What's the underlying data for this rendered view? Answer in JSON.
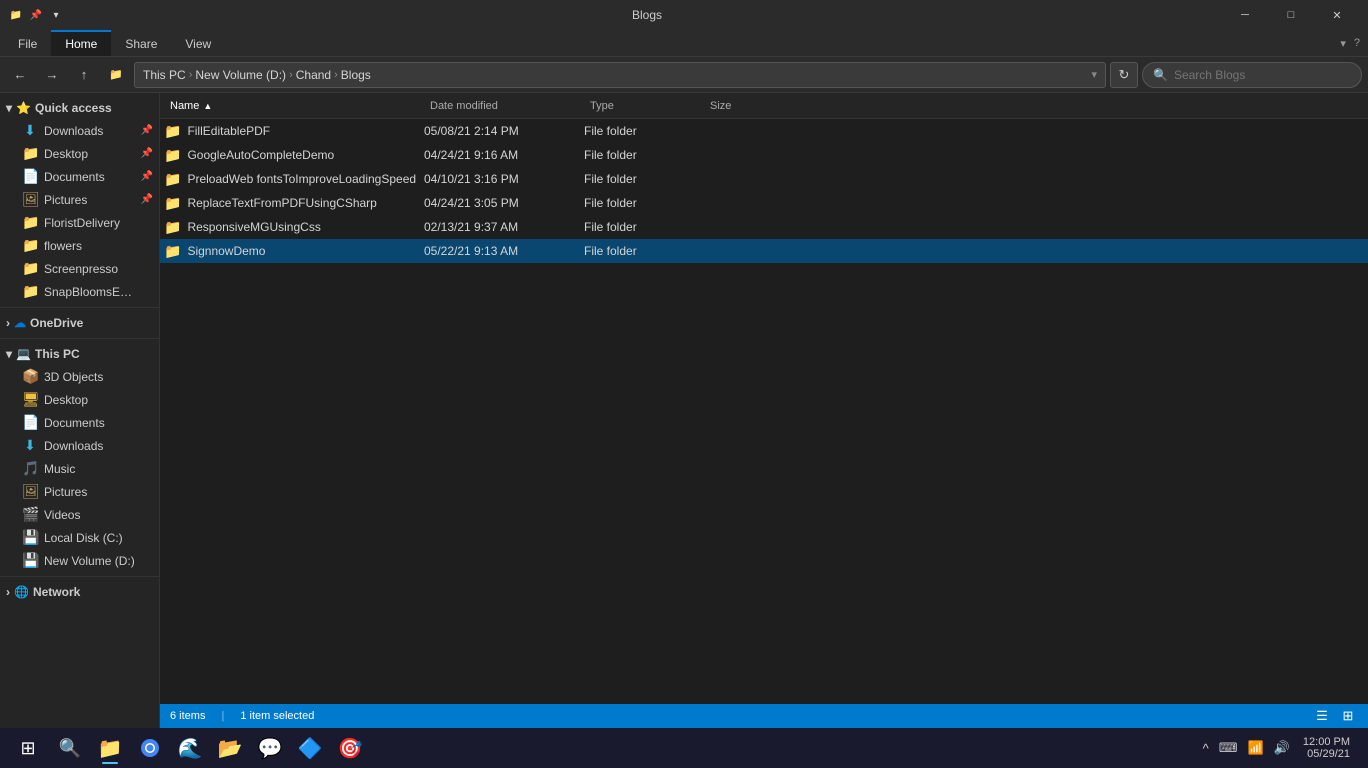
{
  "titlebar": {
    "title": "Blogs",
    "pin_label": "📌",
    "minimize_label": "─",
    "maximize_label": "□",
    "close_label": "✕"
  },
  "ribbon": {
    "tabs": [
      "File",
      "Home",
      "Share",
      "View"
    ],
    "active_tab": "Home",
    "help_icon": "?"
  },
  "addressbar": {
    "back_icon": "←",
    "forward_icon": "→",
    "up_icon": "↑",
    "breadcrumbs": [
      "This PC",
      "New Volume (D:)",
      "Chand",
      "Blogs"
    ],
    "refresh_icon": "↻",
    "search_placeholder": "Search Blogs"
  },
  "sidebar": {
    "sections": [
      {
        "id": "quick-access",
        "label": "Quick access",
        "icon": "⭐",
        "expanded": true,
        "items": [
          {
            "id": "downloads",
            "label": "Downloads",
            "icon": "⬇",
            "icon_class": "folder-download",
            "pinned": true
          },
          {
            "id": "desktop",
            "label": "Desktop",
            "icon": "🖥",
            "icon_class": "folder-yellow",
            "pinned": true
          },
          {
            "id": "documents",
            "label": "Documents",
            "icon": "📄",
            "icon_class": "folder-docs",
            "pinned": true
          },
          {
            "id": "pictures",
            "label": "Pictures",
            "icon": "🖼",
            "icon_class": "folder-pics",
            "pinned": true
          },
          {
            "id": "floristdelivery",
            "label": "FloristDelivery",
            "icon": "📁",
            "icon_class": "folder-yellow"
          },
          {
            "id": "flowers",
            "label": "flowers",
            "icon": "📁",
            "icon_class": "folder-yellow"
          },
          {
            "id": "screenpresso",
            "label": "Screenpresso",
            "icon": "📁",
            "icon_class": "folder-yellow"
          },
          {
            "id": "snapblooms",
            "label": "SnapBloomsEcomm",
            "icon": "📁",
            "icon_class": "folder-yellow"
          }
        ]
      },
      {
        "id": "onedrive",
        "label": "OneDrive",
        "icon": "☁",
        "expanded": false,
        "items": []
      },
      {
        "id": "thispc",
        "label": "This PC",
        "icon": "💻",
        "expanded": true,
        "items": [
          {
            "id": "3dobjects",
            "label": "3D Objects",
            "icon": "📦",
            "icon_class": "folder-3d"
          },
          {
            "id": "desktop2",
            "label": "Desktop",
            "icon": "🖥",
            "icon_class": "folder-yellow"
          },
          {
            "id": "documents2",
            "label": "Documents",
            "icon": "📄",
            "icon_class": "folder-docs"
          },
          {
            "id": "downloads2",
            "label": "Downloads",
            "icon": "⬇",
            "icon_class": "folder-download"
          },
          {
            "id": "music",
            "label": "Music",
            "icon": "🎵",
            "icon_class": "folder-music"
          },
          {
            "id": "pictures2",
            "label": "Pictures",
            "icon": "🖼",
            "icon_class": "folder-pics"
          },
          {
            "id": "videos",
            "label": "Videos",
            "icon": "🎬",
            "icon_class": "folder-video"
          },
          {
            "id": "localdisk",
            "label": "Local Disk (C:)",
            "icon": "💾",
            "icon_class": "drive-icon"
          },
          {
            "id": "newvolume",
            "label": "New Volume (D:)",
            "icon": "💾",
            "icon_class": "drive-icon"
          }
        ]
      },
      {
        "id": "network",
        "label": "Network",
        "icon": "🌐",
        "expanded": false,
        "items": []
      }
    ]
  },
  "filelist": {
    "columns": [
      {
        "id": "name",
        "label": "Name",
        "sort": "asc"
      },
      {
        "id": "date",
        "label": "Date modified"
      },
      {
        "id": "type",
        "label": "Type"
      },
      {
        "id": "size",
        "label": "Size"
      }
    ],
    "rows": [
      {
        "id": 1,
        "name": "FillEditablePDF",
        "date": "05/08/21 2:14 PM",
        "type": "File folder",
        "size": "",
        "selected": false
      },
      {
        "id": 2,
        "name": "GoogleAutoCompleteDemo",
        "date": "04/24/21 9:16 AM",
        "type": "File folder",
        "size": "",
        "selected": false
      },
      {
        "id": 3,
        "name": "PreloadWeb fontsToImproveLoadingSpeed",
        "date": "04/10/21 3:16 PM",
        "type": "File folder",
        "size": "",
        "selected": false
      },
      {
        "id": 4,
        "name": "ReplaceTextFromPDFUsingCSharp",
        "date": "04/24/21 3:05 PM",
        "type": "File folder",
        "size": "",
        "selected": false
      },
      {
        "id": 5,
        "name": "ResponsiveMGUsingCss",
        "date": "02/13/21 9:37 AM",
        "type": "File folder",
        "size": "",
        "selected": false
      },
      {
        "id": 6,
        "name": "SignnowDemo",
        "date": "05/22/21 9:13 AM",
        "type": "File folder",
        "size": "",
        "selected": true
      }
    ]
  },
  "statusbar": {
    "item_count": "6 items",
    "selected_count": "1 item selected",
    "divider": "|"
  },
  "taskbar": {
    "start_icon": "⊞",
    "search_icon": "🔍",
    "apps": [
      {
        "id": "explorer",
        "icon": "📁",
        "active": true
      },
      {
        "id": "chrome",
        "icon": "🔵",
        "active": false
      },
      {
        "id": "edge",
        "icon": "🌊",
        "active": false
      },
      {
        "id": "files",
        "icon": "📂",
        "active": false
      },
      {
        "id": "skype",
        "icon": "💬",
        "active": false
      },
      {
        "id": "vscode",
        "icon": "🔷",
        "active": false
      },
      {
        "id": "app7",
        "icon": "🎯",
        "active": false
      }
    ],
    "tray": {
      "chevron": "^",
      "icons": [
        "⌨",
        "📶",
        "🔊"
      ],
      "time": "12:00 PM",
      "date": "05/29/21"
    }
  }
}
